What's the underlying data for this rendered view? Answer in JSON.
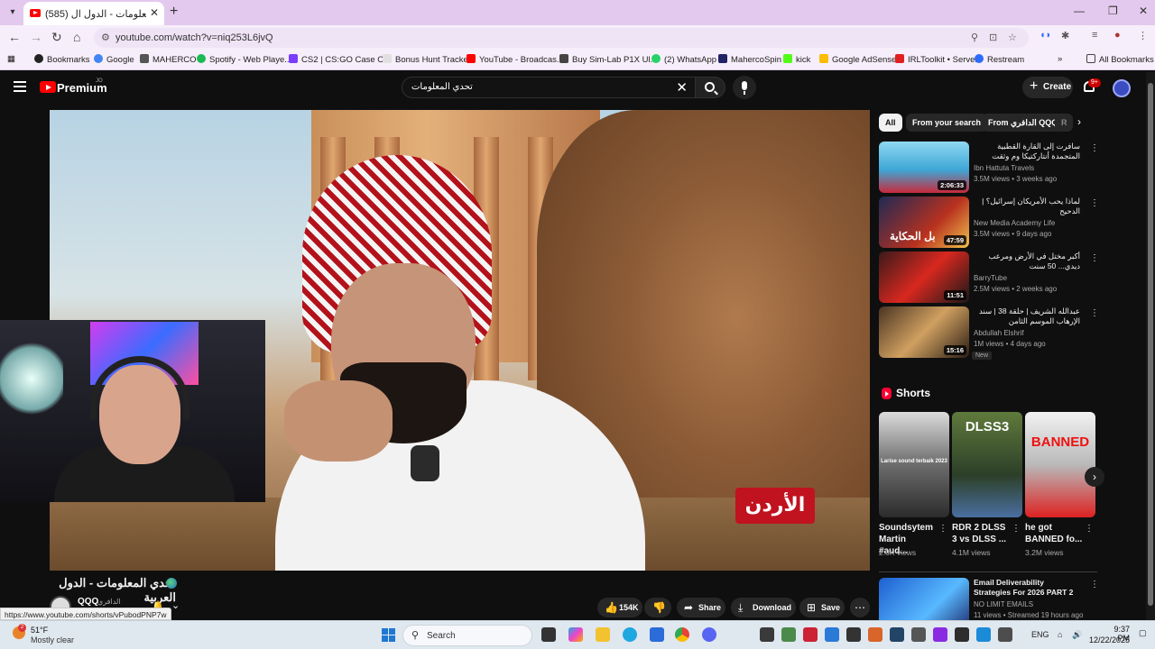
{
  "browser": {
    "tab_title": "(585) تحدي المعلومات - الدول ال",
    "tab_close": "✕",
    "new_tab": "+",
    "url": "youtube.com/watch?v=niq253L6jvQ",
    "bookmarks": [
      {
        "label": "Bookmarks",
        "color": "#222"
      },
      {
        "label": "Google",
        "color": "#4285f4"
      },
      {
        "label": "MAHERCO",
        "color": "#555"
      },
      {
        "label": "Spotify - Web Playe...",
        "color": "#1db954"
      },
      {
        "label": "CS2 | CS:GO Case O...",
        "color": "#7a3cff"
      },
      {
        "label": "Bonus Hunt Tracker",
        "color": "#e0e0e0"
      },
      {
        "label": "YouTube - Broadcas...",
        "color": "#ff0000"
      },
      {
        "label": "Buy Sim-Lab P1X Ul...",
        "color": "#444"
      },
      {
        "label": "(2) WhatsApp",
        "color": "#25d366"
      },
      {
        "label": "MahercoSpin",
        "color": "#222266"
      },
      {
        "label": "kick",
        "color": "#53fc18"
      },
      {
        "label": "Google AdSense",
        "color": "#fbbc04"
      },
      {
        "label": "IRLToolkit • Server",
        "color": "#e02020"
      },
      {
        "label": "Restream",
        "color": "#2d6bff"
      }
    ],
    "all_bookmarks": "All Bookmarks"
  },
  "youtube": {
    "logo_text": "Premium",
    "logo_region": "JO",
    "search_query": "تحدي المعلومات",
    "create_label": "Create",
    "notif_count": "9+"
  },
  "video": {
    "overlay_text": "الأردن",
    "title": "تحدي المعلومات - الدول العربية",
    "channel": "QQQ",
    "channel_sub": "الدافري",
    "likes": "154K",
    "share": "Share",
    "download": "Download",
    "save": "Save"
  },
  "sidebar": {
    "chips": [
      "All",
      "From your search",
      "From الدافري QQQ",
      "R"
    ],
    "recs": [
      {
        "title": "سافرت إلى القارة القطبية المتجمدة أنتاركتيكا وم وثقت التجربة كاملة",
        "channel": "Ibn Hattuta Travels",
        "meta": "3.5M views • 3 weeks ago",
        "duration": "2:06:33"
      },
      {
        "title": "لماذا يحب الأمريكان إسرائيل؟ | الدحيح",
        "channel": "New Media Academy Life",
        "meta": "3.5M views • 9 days ago",
        "duration": "47:59",
        "thumb_text": "بل الحكاية"
      },
      {
        "title": "أكبر مختل في الأرض ومرعب ديدي... 50 سنت",
        "channel": "BarryTube",
        "meta": "2.5M views • 2 weeks ago",
        "duration": "11:51"
      },
      {
        "title": "عبدالله الشريف | حلقة 38 | سند الإرهاب الموسم الثامن",
        "channel": "Abdullah Elshrif",
        "meta": "1M views • 4 days ago",
        "duration": "15:16",
        "badge": "New"
      }
    ],
    "shorts_heading": "Shorts",
    "shorts": [
      {
        "title": "Soundsytem Martin #aud...",
        "views": "2.3K views",
        "thumb_text": "Larise sound terbaik 2023"
      },
      {
        "title": "RDR 2 DLSS 3 vs DLSS ...",
        "views": "4.1M views",
        "thumb_text": "DLSS3"
      },
      {
        "title": "he got BANNED fo...",
        "views": "3.2M views",
        "thumb_text": "BANNED"
      }
    ],
    "rec5": {
      "title": "Email Deliverability Strategies For 2026 PART 2",
      "channel": "NO LIMIT EMAILS",
      "meta": "11 views • Streamed 19 hours ago"
    }
  },
  "status_url": "https://www.youtube.com/shorts/vPubodPNP7w",
  "taskbar": {
    "temp": "51°F",
    "condition": "Mostly clear",
    "weather_badge": "2",
    "search": "Search",
    "lang": "ENG",
    "time": "9:37 PM",
    "date": "12/22/2025"
  }
}
